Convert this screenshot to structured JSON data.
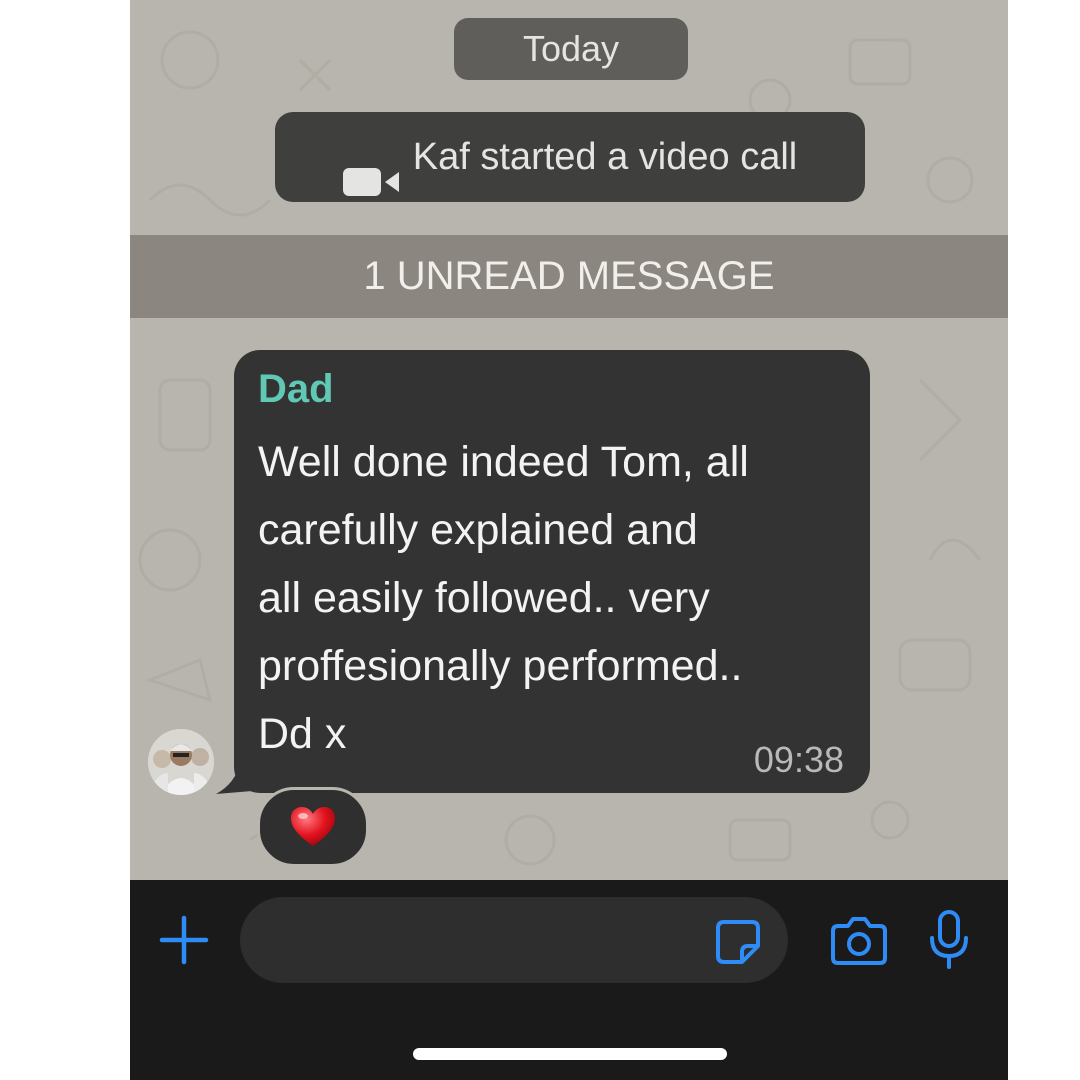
{
  "date_separator": "Today",
  "system_message": {
    "icon": "video-camera-icon",
    "text": "Kaf started a video call"
  },
  "unread_banner": "1 UNREAD MESSAGE",
  "message": {
    "sender": "Dad",
    "lines": [
      "Well done indeed Tom, all",
      "carefully explained and",
      "all easily followed.. very",
      "proffesionally performed..",
      "Dd x"
    ],
    "time": "09:38",
    "reaction": "❤️"
  },
  "composer": {
    "placeholder": "",
    "icons": [
      "plus-icon",
      "sticker-icon",
      "camera-icon",
      "microphone-icon"
    ]
  },
  "colors": {
    "accent": "#2f8cf6",
    "sender_name": "#5fc9b6",
    "bubble": "#333333",
    "chat_background": "#b8b5ae"
  }
}
